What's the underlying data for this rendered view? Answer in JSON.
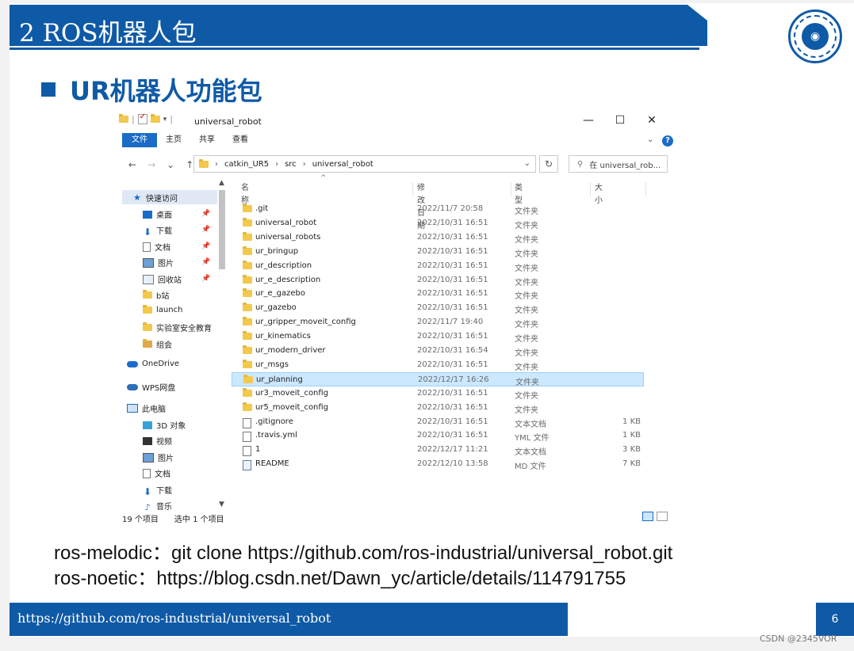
{
  "slide": {
    "title": "2 ROS机器人包",
    "subtitle": "UR机器人功能包",
    "page_number": "6",
    "footer_url": "https://github.com/ros-industrial/universal_robot",
    "commands": [
      "ros-melodic：git clone https://github.com/ros-industrial/universal_robot.git",
      "ros-noetic：https://blog.csdn.net/Dawn_yc/article/details/114791755"
    ],
    "accent_color": "#0f5aa6"
  },
  "explorer": {
    "window_title": "universal_robot",
    "window_buttons": [
      "—",
      "☐",
      "✕"
    ],
    "ribbon_tabs": [
      "文件",
      "主页",
      "共享",
      "查看"
    ],
    "nav_buttons": [
      "←",
      "→",
      "⌄",
      "↑"
    ],
    "breadcrumb": [
      "catkin_UR5",
      "src",
      "universal_robot"
    ],
    "search_placeholder": "在 universal_rob...",
    "columns": [
      "名称",
      "修改日期",
      "类型",
      "大小"
    ],
    "nav_pane": [
      {
        "label": "快速访问",
        "icon": "star-icon"
      },
      {
        "label": "桌面",
        "icon": "desktop-icon",
        "pinned": true
      },
      {
        "label": "下载",
        "icon": "download-icon",
        "pinned": true
      },
      {
        "label": "文档",
        "icon": "document-icon",
        "pinned": true
      },
      {
        "label": "图片",
        "icon": "picture-icon",
        "pinned": true
      },
      {
        "label": "回收站",
        "icon": "recycle-bin-icon",
        "pinned": true
      },
      {
        "label": "b站",
        "icon": "folder-icon"
      },
      {
        "label": "launch",
        "icon": "folder-icon"
      },
      {
        "label": "实验室安全教育",
        "icon": "folder-icon"
      },
      {
        "label": "组会",
        "icon": "folder-icon"
      },
      {
        "label": "OneDrive",
        "icon": "onedrive-icon"
      },
      {
        "label": "WPS网盘",
        "icon": "wps-cloud-icon"
      },
      {
        "label": "此电脑",
        "icon": "this-pc-icon"
      },
      {
        "label": "3D 对象",
        "icon": "3d-objects-icon"
      },
      {
        "label": "视频",
        "icon": "video-icon"
      },
      {
        "label": "图片",
        "icon": "picture-icon"
      },
      {
        "label": "文档",
        "icon": "document-icon"
      },
      {
        "label": "下载",
        "icon": "download-icon"
      },
      {
        "label": "音乐",
        "icon": "music-icon"
      }
    ],
    "files": [
      {
        "name": ".git",
        "date": "2022/11/7 20:58",
        "type": "文件夹",
        "size": "",
        "kind": "folder"
      },
      {
        "name": "universal_robot",
        "date": "2022/10/31 16:51",
        "type": "文件夹",
        "size": "",
        "kind": "folder"
      },
      {
        "name": "universal_robots",
        "date": "2022/10/31 16:51",
        "type": "文件夹",
        "size": "",
        "kind": "folder"
      },
      {
        "name": "ur_bringup",
        "date": "2022/10/31 16:51",
        "type": "文件夹",
        "size": "",
        "kind": "folder"
      },
      {
        "name": "ur_description",
        "date": "2022/10/31 16:51",
        "type": "文件夹",
        "size": "",
        "kind": "folder"
      },
      {
        "name": "ur_e_description",
        "date": "2022/10/31 16:51",
        "type": "文件夹",
        "size": "",
        "kind": "folder"
      },
      {
        "name": "ur_e_gazebo",
        "date": "2022/10/31 16:51",
        "type": "文件夹",
        "size": "",
        "kind": "folder"
      },
      {
        "name": "ur_gazebo",
        "date": "2022/10/31 16:51",
        "type": "文件夹",
        "size": "",
        "kind": "folder"
      },
      {
        "name": "ur_gripper_moveit_config",
        "date": "2022/11/7 19:40",
        "type": "文件夹",
        "size": "",
        "kind": "folder"
      },
      {
        "name": "ur_kinematics",
        "date": "2022/10/31 16:51",
        "type": "文件夹",
        "size": "",
        "kind": "folder"
      },
      {
        "name": "ur_modern_driver",
        "date": "2022/10/31 16:54",
        "type": "文件夹",
        "size": "",
        "kind": "folder"
      },
      {
        "name": "ur_msgs",
        "date": "2022/10/31 16:51",
        "type": "文件夹",
        "size": "",
        "kind": "folder"
      },
      {
        "name": "ur_planning",
        "date": "2022/12/17 16:26",
        "type": "文件夹",
        "size": "",
        "kind": "folder",
        "selected": true
      },
      {
        "name": "ur3_moveit_config",
        "date": "2022/10/31 16:51",
        "type": "文件夹",
        "size": "",
        "kind": "folder"
      },
      {
        "name": "ur5_moveit_config",
        "date": "2022/10/31 16:51",
        "type": "文件夹",
        "size": "",
        "kind": "folder"
      },
      {
        "name": ".gitignore",
        "date": "2022/10/31 16:51",
        "type": "文本文档",
        "size": "1 KB",
        "kind": "file"
      },
      {
        "name": ".travis.yml",
        "date": "2022/10/31 16:51",
        "type": "YML 文件",
        "size": "1 KB",
        "kind": "file"
      },
      {
        "name": "1",
        "date": "2022/12/17 11:21",
        "type": "文本文档",
        "size": "3 KB",
        "kind": "file"
      },
      {
        "name": "README",
        "date": "2022/12/10 13:58",
        "type": "MD 文件",
        "size": "7 KB",
        "kind": "md"
      }
    ],
    "status_count": "19 个项目",
    "status_selected": "选中 1 个项目"
  },
  "watermark": "CSDN @2345VOR"
}
